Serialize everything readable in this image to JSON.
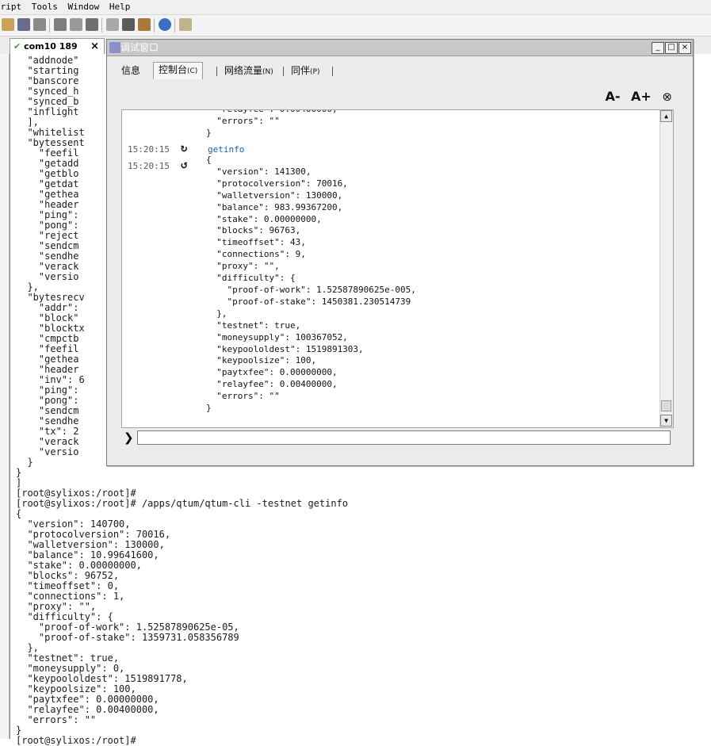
{
  "menubar": {
    "items": [
      "cript",
      "Tools",
      "Window",
      "Help"
    ]
  },
  "toolbar": {
    "icons": [
      "paste-icon",
      "find-icon",
      "print-icon",
      "settings-icon",
      "help-icon"
    ]
  },
  "session_tab": {
    "label": "com10 189",
    "close_glyph": "×",
    "check_glyph": "✔"
  },
  "debug_window": {
    "title": "调试窗口",
    "buttons": {
      "minimize": "_",
      "restore": "□",
      "close": "×"
    },
    "tabs": [
      {
        "label": "信息",
        "accel": ""
      },
      {
        "label": "控制台",
        "accel": "(C)"
      },
      {
        "label": "网络流量",
        "accel": "(N)"
      },
      {
        "label": "同伴",
        "accel": "(P)"
      }
    ],
    "font_controls": {
      "decrease": "A-",
      "increase": "A+",
      "clear": "⊗"
    },
    "console": {
      "partial_top": "  \"relayfee\": 0.00400000,\n  \"errors\": \"\"\n}",
      "entries": [
        {
          "time": "15:20:15",
          "text": "getinfo"
        },
        {
          "time": "15:20:15",
          "text": "{\n  \"version\": 141300,\n  \"protocolversion\": 70016,\n  \"walletversion\": 130000,\n  \"balance\": 983.99367200,\n  \"stake\": 0.00000000,\n  \"blocks\": 96763,\n  \"timeoffset\": 43,\n  \"connections\": 9,\n  \"proxy\": \"\",\n  \"difficulty\": {\n    \"proof-of-work\": 1.52587890625e-005,\n    \"proof-of-stake\": 1450381.230514739\n  },\n  \"testnet\": true,\n  \"moneysupply\": 100367052,\n  \"keypoololdest\": 1519891303,\n  \"keypoolsize\": 100,\n  \"paytxfee\": 0.00000000,\n  \"relayfee\": 0.00400000,\n  \"errors\": \"\"\n}"
        }
      ],
      "prompt_glyph": "❯",
      "input_value": ""
    }
  },
  "terminal": {
    "text": "  \"addnode\"\n  \"starting\n  \"banscore\n  \"synced_h\n  \"synced_b\n  \"inflight\n  ],\n  \"whitelist\n  \"bytessent\n    \"feefil\n    \"getadd\n    \"getblo\n    \"getdat\n    \"gethea\n    \"header\n    \"ping\":\n    \"pong\":\n    \"reject\n    \"sendcm\n    \"sendhe\n    \"verack\n    \"versio\n  },\n  \"bytesrecv\n    \"addr\":\n    \"block\"\n    \"blocktx\n    \"cmpctb\n    \"feefil\n    \"gethea\n    \"header\n    \"inv\": 6\n    \"ping\":\n    \"pong\":\n    \"sendcm\n    \"sendhe\n    \"tx\": 2\n    \"verack\n    \"versio\n  }\n}\n]\n[root@sylixos:/root]#\n[root@sylixos:/root]# /apps/qtum/qtum-cli -testnet getinfo\n{\n  \"version\": 140700,\n  \"protocolversion\": 70016,\n  \"walletversion\": 130000,\n  \"balance\": 10.99641600,\n  \"stake\": 0.00000000,\n  \"blocks\": 96752,\n  \"timeoffset\": 0,\n  \"connections\": 1,\n  \"proxy\": \"\",\n  \"difficulty\": {\n    \"proof-of-work\": 1.52587890625e-05,\n    \"proof-of-stake\": 1359731.058356789\n  },\n  \"testnet\": true,\n  \"moneysupply\": 0,\n  \"keypoololdest\": 1519891778,\n  \"keypoolsize\": 100,\n  \"paytxfee\": 0.00000000,\n  \"relayfee\": 0.00400000,\n  \"errors\": \"\"\n}\n[root@sylixos:/root]#"
  },
  "colors": {
    "command": "#1a5fb4",
    "check": "#3aa23a",
    "title_bar": "#c8c8c8"
  }
}
